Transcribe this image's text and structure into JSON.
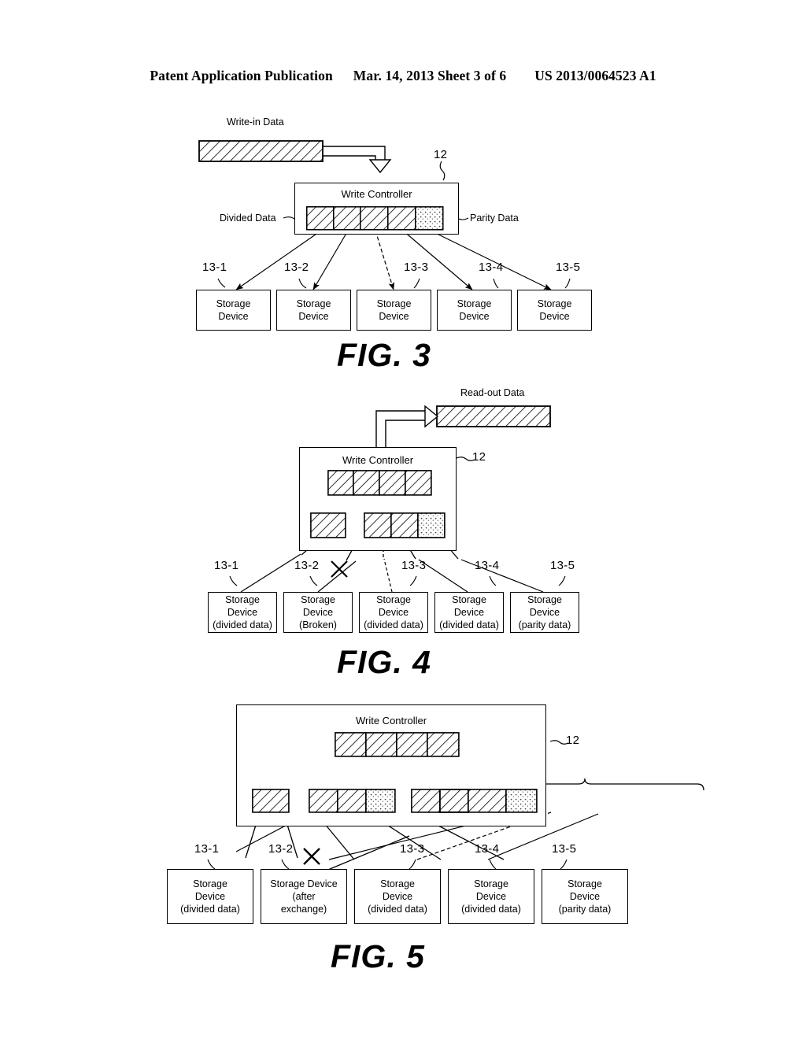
{
  "header": {
    "publication": "Patent Application Publication",
    "date_sheet": "Mar. 14, 2013  Sheet 3 of 6",
    "patent_number": "US 2013/0064523 A1"
  },
  "figures": [
    {
      "id": "fig3",
      "caption": "FIG. 3",
      "labels": {
        "write_in_data": "Write-in Data",
        "controller_title": "Write Controller",
        "divided_data": "Divided Data",
        "parity_data": "Parity Data",
        "controller_ref": "12"
      },
      "buffer_blocks": [
        {
          "fill": "hatch"
        },
        {
          "fill": "hatch"
        },
        {
          "fill": "hatch"
        },
        {
          "fill": "hatch"
        },
        {
          "fill": "dots"
        }
      ],
      "storage_devices": [
        {
          "ref": "13-1",
          "line1": "Storage",
          "line2": "Device",
          "line3": ""
        },
        {
          "ref": "13-2",
          "line1": "Storage",
          "line2": "Device",
          "line3": ""
        },
        {
          "ref": "13-3",
          "line1": "Storage",
          "line2": "Device",
          "line3": ""
        },
        {
          "ref": "13-4",
          "line1": "Storage",
          "line2": "Device",
          "line3": ""
        },
        {
          "ref": "13-5",
          "line1": "Storage",
          "line2": "Device",
          "line3": ""
        }
      ]
    },
    {
      "id": "fig4",
      "caption": "FIG. 4",
      "labels": {
        "read_out_data": "Read-out Data",
        "controller_title": "Write Controller",
        "controller_ref": "12"
      },
      "top_blocks": [
        {
          "fill": "hatch"
        },
        {
          "fill": "hatch"
        },
        {
          "fill": "hatch"
        },
        {
          "fill": "hatch"
        }
      ],
      "lower_left_blocks": [
        {
          "fill": "hatch"
        }
      ],
      "lower_right_blocks": [
        {
          "fill": "hatch"
        },
        {
          "fill": "hatch"
        },
        {
          "fill": "dots"
        }
      ],
      "storage_devices": [
        {
          "ref": "13-1",
          "line1": "Storage",
          "line2": "Device",
          "line3": "(divided data)"
        },
        {
          "ref": "13-2",
          "line1": "Storage",
          "line2": "Device",
          "line3": "(Broken)"
        },
        {
          "ref": "13-3",
          "line1": "Storage",
          "line2": "Device",
          "line3": "(divided data)"
        },
        {
          "ref": "13-4",
          "line1": "Storage",
          "line2": "Device",
          "line3": "(divided data)"
        },
        {
          "ref": "13-5",
          "line1": "Storage",
          "line2": "Device",
          "line3": "(parity data)"
        }
      ]
    },
    {
      "id": "fig5",
      "caption": "FIG. 5",
      "labels": {
        "controller_title": "Write Controller",
        "controller_ref": "12"
      },
      "top_blocks": [
        {
          "fill": "hatch"
        },
        {
          "fill": "hatch"
        },
        {
          "fill": "hatch"
        },
        {
          "fill": "hatch"
        }
      ],
      "lower_left_blocks": [
        {
          "fill": "hatch"
        }
      ],
      "lower_mid_blocks": [
        {
          "fill": "hatch"
        },
        {
          "fill": "hatch"
        },
        {
          "fill": "dots"
        }
      ],
      "lower_right_blocks": [
        {
          "fill": "hatch"
        },
        {
          "fill": "hatch"
        },
        {
          "fill": "hatch"
        },
        {
          "fill": "dots"
        }
      ],
      "storage_devices": [
        {
          "ref": "13-1",
          "line1": "Storage",
          "line2": "Device",
          "line3": "(divided data)"
        },
        {
          "ref": "13-2",
          "line1": "Storage Device",
          "line2": "(after",
          "line3": "exchange)"
        },
        {
          "ref": "13-3",
          "line1": "Storage",
          "line2": "Device",
          "line3": "(divided data)"
        },
        {
          "ref": "13-4",
          "line1": "Storage",
          "line2": "Device",
          "line3": "(divided data)"
        },
        {
          "ref": "13-5",
          "line1": "Storage",
          "line2": "Device",
          "line3": "(parity  data)"
        }
      ]
    }
  ]
}
